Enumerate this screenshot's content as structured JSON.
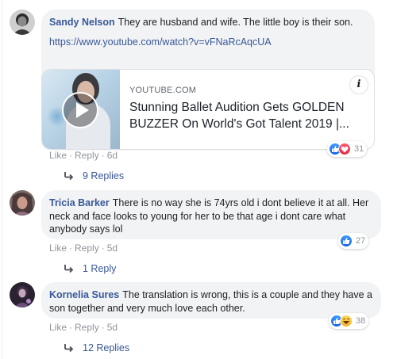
{
  "comments": [
    {
      "author": "Sandy Nelson",
      "text": "They are husband and wife. The little boy is their son.",
      "link": "https://www.youtube.com/watch?v=vFNaRcAqcUA",
      "preview": {
        "source": "YOUTUBE.COM",
        "title": "Stunning Ballet Audition Gets GOLDEN BUZZER On World's Got Talent 2019 |..."
      },
      "actions": {
        "like": "Like",
        "reply": "Reply",
        "time": "6d"
      },
      "reaction_count": "31",
      "replies": "9 Replies"
    },
    {
      "author": "Tricia Barker",
      "text": "There is no way she is 74yrs old i dont believe it at all. Her neck and face looks to young for her to be that age i dont care what anybody says lol",
      "actions": {
        "like": "Like",
        "reply": "Reply",
        "time": "5d"
      },
      "reaction_count": "27",
      "replies": "1 Reply"
    },
    {
      "author": "Kornelia Sures",
      "text": "The translation is wrong, this is a couple and they have a son together and very much love each other.",
      "actions": {
        "like": "Like",
        "reply": "Reply",
        "time": "5d"
      },
      "reaction_count": "38",
      "replies": "12 Replies"
    }
  ],
  "colors": {
    "author": "#385898",
    "bubble": "#f2f3f5",
    "meta": "#90949c",
    "like": "#1877f2",
    "love": "#e22c3f",
    "haha": "#f6b02e"
  },
  "icons": [
    "play-icon",
    "info-icon",
    "like-reaction-icon",
    "love-reaction-icon",
    "haha-reaction-icon",
    "reply-arrow-icon"
  ]
}
